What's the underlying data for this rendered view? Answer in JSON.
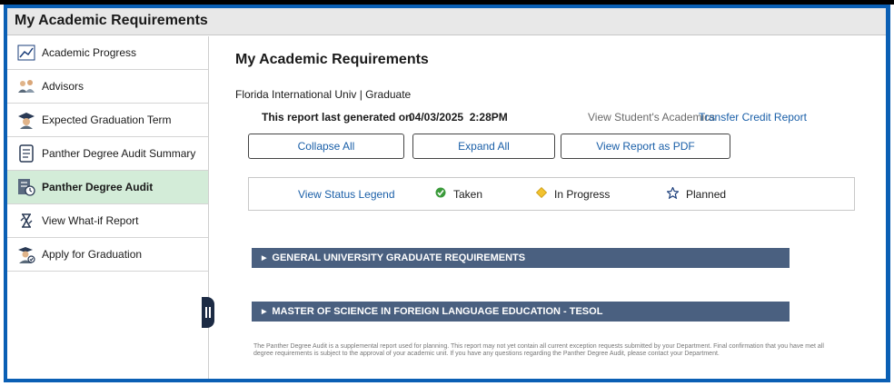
{
  "window": {
    "title": "My Academic Requirements"
  },
  "sidebar": {
    "items": [
      {
        "label": "Academic Progress",
        "icon": "chart-line-icon",
        "active": false
      },
      {
        "label": "Advisors",
        "icon": "people-icon",
        "active": false
      },
      {
        "label": "Expected Graduation Term",
        "icon": "graduate-icon",
        "active": false
      },
      {
        "label": "Panther Degree Audit Summary",
        "icon": "document-icon",
        "active": false
      },
      {
        "label": "Panther Degree Audit",
        "icon": "audit-doc-icon",
        "active": true
      },
      {
        "label": "View What-if Report",
        "icon": "what-if-icon",
        "active": false
      },
      {
        "label": "Apply for Graduation",
        "icon": "graduate-apply-icon",
        "active": false
      }
    ]
  },
  "main": {
    "title": "My Academic Requirements",
    "institution": "Florida International Univ | Graduate",
    "generated_label": "This report last generated on",
    "generated_date": "04/03/2025  2:28PM",
    "view_academics": "View Student's Academics",
    "transfer_link": "Transfer Credit Report",
    "buttons": {
      "collapse": "Collapse All",
      "expand": "Expand All",
      "pdf": "View Report as PDF"
    },
    "legend": {
      "link": "View Status Legend",
      "taken": "Taken",
      "in_progress": "In Progress",
      "planned": "Planned"
    },
    "sections": [
      {
        "label": "GENERAL UNIVERSITY GRADUATE REQUIREMENTS"
      },
      {
        "label": "MASTER OF SCIENCE IN FOREIGN LANGUAGE EDUCATION - TESOL"
      }
    ],
    "footnote": "The Panther Degree Audit is a supplemental report used for planning. This report may not yet contain all current exception requests submitted by your Department. Final confirmation that you have met all degree requirements is subject to the approval of your academic unit. If you have any questions regarding the Panther Degree Audit, please contact your Department."
  },
  "colors": {
    "frame_border": "#0a5fb4",
    "active_nav": "#d3ecd8",
    "section_bar": "#4a6080",
    "link": "#1a5fa8"
  }
}
